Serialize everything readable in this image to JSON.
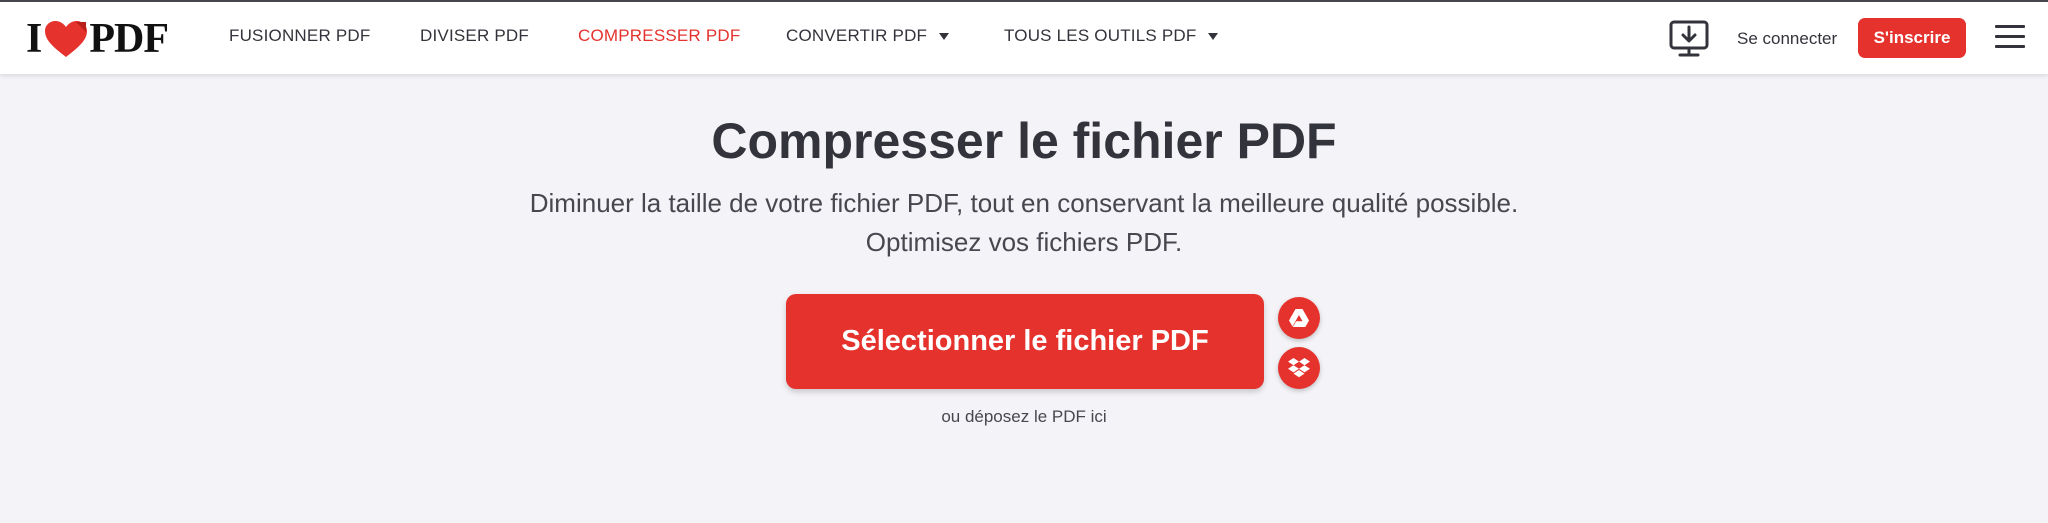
{
  "brand": {
    "logo_left": "I",
    "logo_right": "PDF",
    "accent_color": "#e5322d"
  },
  "nav": {
    "items": [
      {
        "label": "FUSIONNER PDF"
      },
      {
        "label": "DIVISER PDF"
      },
      {
        "label": "COMPRESSER PDF",
        "active": true
      },
      {
        "label": "CONVERTIR PDF",
        "dropdown": true
      },
      {
        "label": "TOUS LES OUTILS PDF",
        "dropdown": true
      }
    ]
  },
  "header_actions": {
    "desktop_icon": "desktop-download-icon",
    "login_label": "Se connecter",
    "signup_label": "S'inscrire",
    "menu_icon": "hamburger-icon"
  },
  "main": {
    "title": "Compresser le fichier PDF",
    "subtitle": "Diminuer la taille de votre fichier PDF, tout en conservant la meilleure qualité possible. Optimisez vos fichiers PDF.",
    "select_button_label": "Sélectionner le fichier PDF",
    "google_drive_icon": "google-drive-icon",
    "dropbox_icon": "dropbox-icon",
    "drop_hint": "ou déposez le PDF ici"
  }
}
